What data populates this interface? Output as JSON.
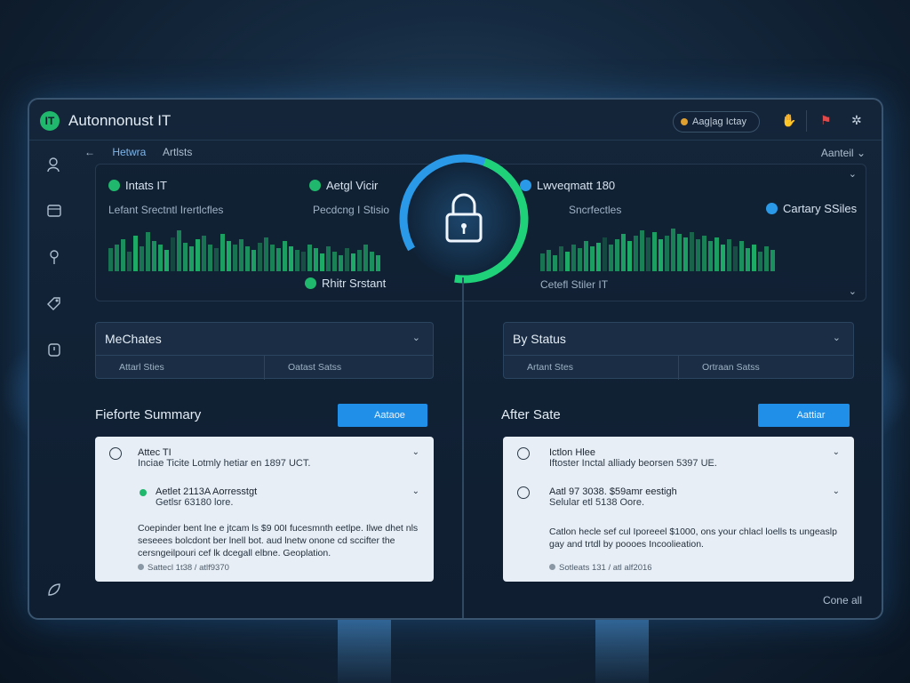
{
  "window": {
    "app_title": "Autonnonust IT",
    "logo_text": "IT",
    "status_pill": "Aag|ag Ictay"
  },
  "nav": {
    "back_icon": "arrow-left-icon",
    "tabs": [
      {
        "label": "Hetwra",
        "active": true
      },
      {
        "label": "Artlsts",
        "active": false
      }
    ],
    "right_label": "Aanteil"
  },
  "overview": {
    "left_title": "Intats IT",
    "left_sub": "Lefant Srectntl Irertlcfles",
    "mid_top": "Aetgl Vicir",
    "mid_sub": "Pecdcng I Stisio",
    "mid_bottom": "Rhitr Srstant",
    "right_title": "Lwveqmatt 180",
    "right_sub": "Sncrfectles",
    "right_badge": "Cartary SSiles",
    "right_bottom": "Cetefl Stiler IT",
    "bar_colors": [
      "#1fb86c",
      "#2a9ae8",
      "#1c6a4e"
    ]
  },
  "dropdowns": [
    {
      "title": "MeChates",
      "subs": [
        "Attarl Sties",
        "Oatast Satss"
      ]
    },
    {
      "title": "By Status",
      "subs": [
        "Artant Stes",
        "Ortraan Satss"
      ]
    }
  ],
  "sections": [
    {
      "title": "Fieforte Summary",
      "button": "Aataoe"
    },
    {
      "title": "After Sate",
      "button": "Aattiar"
    }
  ],
  "cards": [
    {
      "item1_title": "Attec TI",
      "item1_sub": "Inciae Ticite Lotmly hetiar en 1897 UCT.",
      "item2_title": "Aetlet 2113A Aorresstgt",
      "item2_sub": "Getlsr 63180 lore.",
      "para": "Coepinder bent lne e jtcam ls $9 00I fucesmnth eetlpe. Ilwe dhet nls seseees bolcdont ber lnell bot. aud lnetw onone cd sccifter the cersngeilpouri cef lk dcegall elbne. Geoplation.",
      "meta": "Sattecl 1t38 / atlf9370"
    },
    {
      "item1_title": "Ictlon Hlee",
      "item1_sub": "Iftoster Inctal alliady beorsen 5397 UE.",
      "item2_title": "Aatl 97 3038. $59amr eestigh",
      "item2_sub": "Selular etl 5138 Oore.",
      "para": "Catlon hecle sef cul Iporeeel $1000, ons your chlacl loells ts ungeaslp gay and trtdl by poooes Incoolieation.",
      "meta": "Sotleats 131 / atl alf2016"
    }
  ],
  "footer": {
    "link": "Cone all"
  },
  "sidebar": {
    "icons": [
      "user-icon",
      "calendar-icon",
      "location-pin-icon",
      "tag-icon",
      "clock-icon",
      "leaf-icon"
    ]
  },
  "colors": {
    "accent_green": "#1fb86c",
    "accent_blue": "#2a9ae8",
    "button_blue": "#1f8fe8",
    "panel_bg": "#14253a",
    "card_bg": "#e8eef5"
  }
}
